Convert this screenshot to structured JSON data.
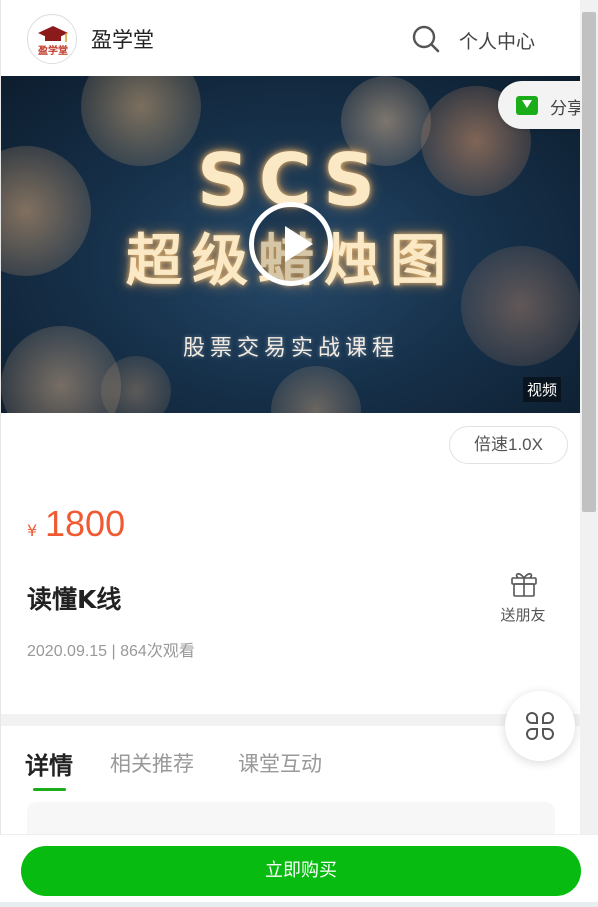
{
  "header": {
    "brand": "盈学堂",
    "logo_text": "盈学堂",
    "user_center": "个人中心"
  },
  "video": {
    "title_line1": "SCS",
    "title_line2": "超级蜡烛图",
    "subtitle": "股票交易实战课程",
    "tag": "视频"
  },
  "share": {
    "label": "分享"
  },
  "player": {
    "speed_label": "倍速1.0X"
  },
  "course": {
    "price_symbol": "¥",
    "price": "1800",
    "title": "读懂K线",
    "meta": "2020.09.15 | 864次观看",
    "gift_label": "送朋友"
  },
  "tabs": [
    {
      "label": "详情"
    },
    {
      "label": "相关推荐"
    },
    {
      "label": "课堂互动"
    }
  ],
  "bottom": {
    "buy_label": "立即购买"
  },
  "colors": {
    "accent_green": "#08bb10",
    "price_orange": "#f05a33",
    "share_green": "#1aad19"
  },
  "icons": {
    "search": "search-icon",
    "play": "play-icon",
    "gift": "gift-icon",
    "menu": "grid-menu-icon",
    "share": "wechat-share-icon"
  }
}
